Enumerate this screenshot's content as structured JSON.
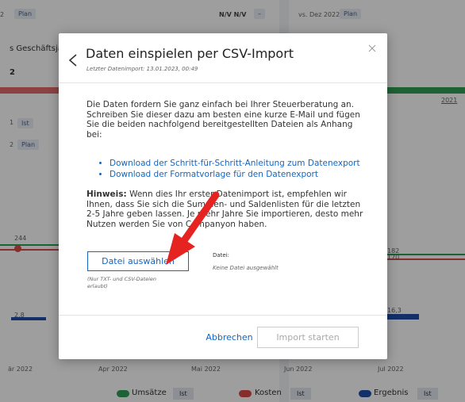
{
  "background": {
    "header_left_number": "2",
    "header_left_badge": "Plan",
    "header_mid_value": "N/V N/V",
    "header_mid_dash": "–",
    "header_right_label": "vs. Dez 2022",
    "header_right_badge": "Plan",
    "geschaeftsjahr": "s Geschäftsjah",
    "left_number": "2",
    "ist_number": "1",
    "ist_badge": "Ist",
    "plan_number": "2",
    "plan_badge": "Plan",
    "year_label": "2021",
    "value_left_top": "244",
    "value_left_bottom": "2,8",
    "value_right_top": "182",
    "value_right_mid": "170",
    "value_right_bottom": "16,3",
    "x_labels": [
      "är 2022",
      "Apr 2022",
      "Mai 2022",
      "Jun 2022",
      "Jul 2022"
    ],
    "legend": [
      {
        "label": "Umsätze",
        "chip": "Ist",
        "color": "#2e9e55"
      },
      {
        "label": "Kosten",
        "chip": "Ist",
        "color": "#d94a4a"
      },
      {
        "label": "Ergebnis",
        "chip": "Ist",
        "color": "#1f4fa8"
      }
    ]
  },
  "modal": {
    "title": "Daten einspielen per CSV-Import",
    "subtitle": "Letzter Datenimport: 13.01.2023, 00:49",
    "intro": "Die Daten fordern Sie ganz einfach bei Ihrer Steuerberatung an. Schreiben Sie dieser dazu am besten eine kurze E-Mail und fügen Sie die beiden nachfolgend bereitgestellten Dateien als Anhang bei:",
    "links": [
      "Download der Schritt-für-Schritt-Anleitung zum Datenexport",
      "Download der Formatvorlage für den Datenexport"
    ],
    "hint_label": "Hinweis:",
    "hint_text": " Wenn dies Ihr erster Datenimport ist, empfehlen wir Ihnen, dass Sie sich die Summen- und Saldenlisten für die letzten 2-5 Jahre geben lassen. Je mehr Jahre Sie importieren, desto mehr Nutzen werden Sie von Companyon haben.",
    "file_button": "Datei auswählen",
    "file_note": "(Nur TXT- und CSV-Dateien erlaubt)",
    "file_label": "Datei:",
    "file_value": "Keine Datei ausgewählt",
    "cancel": "Abbrechen",
    "import": "Import starten"
  },
  "colors": {
    "accent": "#1565c0",
    "arrow": "#e52421"
  }
}
